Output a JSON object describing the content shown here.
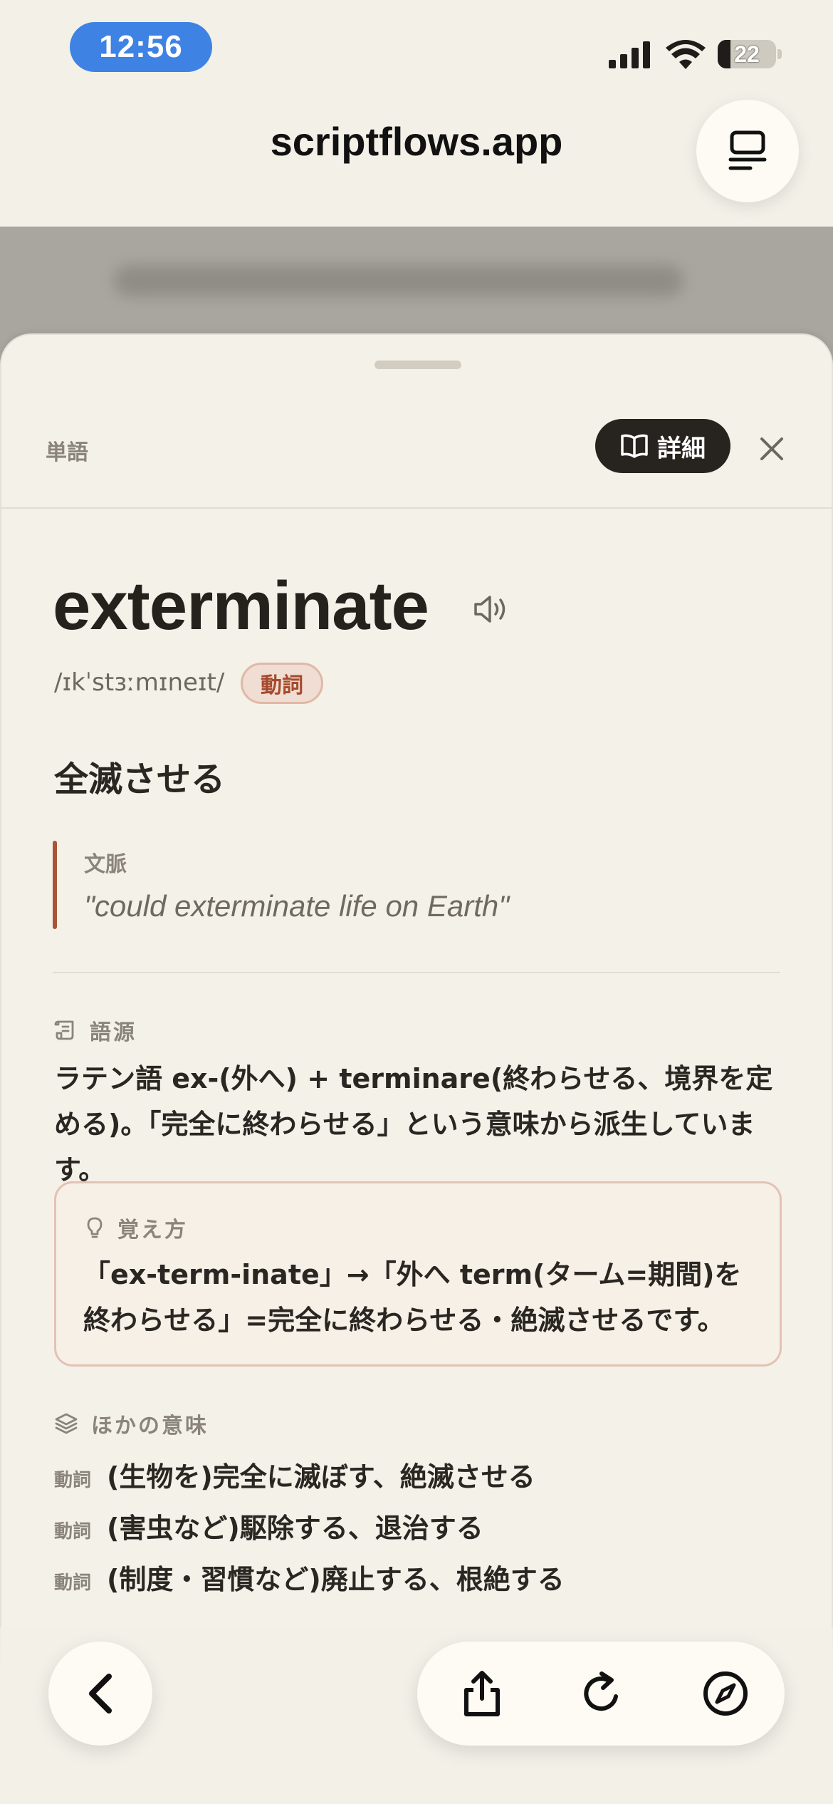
{
  "status_bar": {
    "time": "12:56",
    "battery_level": "22",
    "battery_fraction": 0.22
  },
  "browser": {
    "url": "scriptflows.app"
  },
  "sheet": {
    "kind_label": "単語",
    "detail_label": "詳細",
    "word": "exterminate",
    "phonetic": "/ɪkˈstɜːmɪneɪt/",
    "pos": "動詞",
    "meaning": "全滅させる",
    "context": {
      "label": "文脈",
      "quote": "\"could exterminate life on Earth\""
    },
    "etymology": {
      "label": "語源",
      "text": "ラテン語 ex-(外へ) + terminare(終わらせる、境界を定める)。「完全に終わらせる」という意味から派生しています。"
    },
    "memo": {
      "label": "覚え方",
      "text": "「ex-term-inate」→「外へ term(ターム=期間)を終わらせる」=完全に終わらせる・絶滅させるです。"
    },
    "other_meanings": {
      "label": "ほかの意味",
      "items": [
        {
          "pos": "動詞",
          "text": "(生物を)完全に滅ぼす、絶滅させる"
        },
        {
          "pos": "動詞",
          "text": "(害虫など)駆除する、退治する"
        },
        {
          "pos": "動詞",
          "text": "(制度・習慣など)廃止する、根絶する"
        }
      ]
    }
  },
  "colors": {
    "accent": "#a85437",
    "time_pill": "#3e82e4",
    "dark_button": "#27231f",
    "sheet_bg": "#f4f1e9"
  },
  "icons": {
    "tabs": "tabs-icon",
    "close": "close-icon",
    "speaker": "speaker-icon",
    "book": "book-icon",
    "scroll": "scroll-icon",
    "bulb": "lightbulb-icon",
    "layers": "layers-icon",
    "back": "chevron-left-icon",
    "share": "share-icon",
    "reload": "reload-icon",
    "compass": "compass-icon"
  }
}
